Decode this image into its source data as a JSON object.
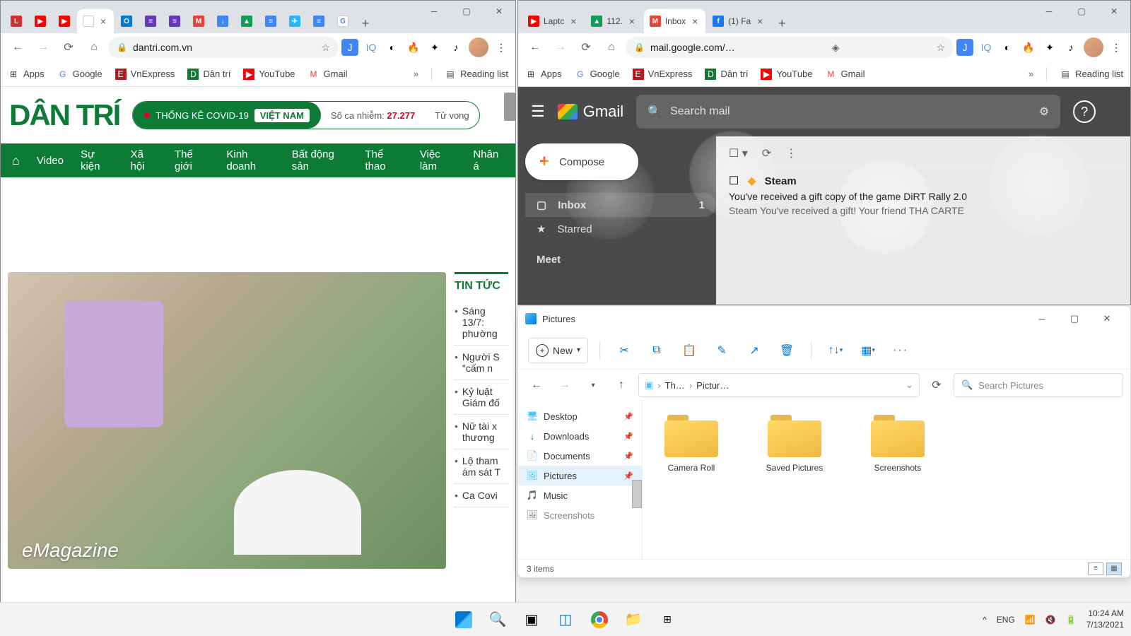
{
  "left_chrome": {
    "tabs": [
      {
        "favicon_bg": "#d32f2f",
        "favicon_text": "L"
      },
      {
        "favicon_bg": "#ff0000",
        "favicon_text": "▶"
      },
      {
        "favicon_bg": "#ff0000",
        "favicon_text": "▶"
      },
      {
        "favicon_bg": "#fff",
        "favicon_text": "",
        "active": true,
        "closable": true
      },
      {
        "favicon_bg": "#0078d4",
        "favicon_text": "O"
      },
      {
        "favicon_bg": "#673ab7",
        "favicon_text": "≡"
      },
      {
        "favicon_bg": "#673ab7",
        "favicon_text": "≡"
      },
      {
        "favicon_bg": "#ea4335",
        "favicon_text": "M"
      },
      {
        "favicon_bg": "#4285f4",
        "favicon_text": "↓"
      },
      {
        "favicon_bg": "#0f9d58",
        "favicon_text": "▲"
      },
      {
        "favicon_bg": "#4285f4",
        "favicon_text": "≡"
      },
      {
        "favicon_bg": "#29b6f6",
        "favicon_text": "✈"
      },
      {
        "favicon_bg": "#4285f4",
        "favicon_text": "≡"
      },
      {
        "favicon_bg": "#fff",
        "favicon_text": "G"
      }
    ],
    "url": "dantri.com.vn",
    "bookmarks": [
      {
        "icon": "⊞",
        "label": "Apps"
      },
      {
        "icon": "G",
        "label": "Google"
      },
      {
        "icon": "E",
        "label": "VnExpress",
        "icon_bg": "#b71c1c"
      },
      {
        "icon": "D",
        "label": "Dân trí",
        "icon_bg": "#0d7a36"
      },
      {
        "icon": "▶",
        "label": "YouTube",
        "icon_bg": "#ff0000"
      },
      {
        "icon": "M",
        "label": "Gmail"
      }
    ],
    "overflow": "»",
    "reading_list": "Reading list"
  },
  "dantri": {
    "logo": "DÂN TRÍ",
    "covid_label": "THỐNG KÊ COVID-19",
    "covid_vn": "VIỆT NAM",
    "stats_label": "Số ca nhiễm:",
    "stats_num": "27.277",
    "stats_right": "Tử vong",
    "nav": [
      "Video",
      "Sự kiện",
      "Xã hội",
      "Thế giới",
      "Kinh doanh",
      "Bất động sản",
      "Thể thao",
      "Việc làm",
      "Nhân á"
    ],
    "hero_tag": "eMagazine",
    "sidebar_title": "TIN TỨC",
    "items": [
      "Sáng 13/7: phường",
      "Người S \"cấm n",
      "Kỷ luật Giám đố",
      "Nữ tài x thương",
      "Lộ tham ám sát T",
      "Ca Covi"
    ]
  },
  "right_chrome": {
    "tabs": [
      {
        "favicon_bg": "#ff0000",
        "favicon_text": "▶",
        "label": "Laptc",
        "closable": true
      },
      {
        "favicon_bg": "#0f9d58",
        "favicon_text": "▲",
        "label": "112.",
        "closable": true
      },
      {
        "favicon_bg": "#ea4335",
        "favicon_text": "M",
        "label": "Inbox",
        "closable": true,
        "active": true
      },
      {
        "favicon_bg": "#1877f2",
        "favicon_text": "f",
        "label": "(1) Fa",
        "closable": true
      }
    ],
    "url": "mail.google.com/…",
    "bookmarks": [
      {
        "icon": "⊞",
        "label": "Apps"
      },
      {
        "icon": "G",
        "label": "Google"
      },
      {
        "icon": "E",
        "label": "VnExpress",
        "icon_bg": "#b71c1c"
      },
      {
        "icon": "D",
        "label": "Dân trí",
        "icon_bg": "#0d7a36"
      },
      {
        "icon": "▶",
        "label": "YouTube",
        "icon_bg": "#ff0000"
      },
      {
        "icon": "M",
        "label": "Gmail"
      }
    ],
    "overflow": "»",
    "reading_list": "Reading list"
  },
  "gmail": {
    "brand": "Gmail",
    "search_ph": "Search mail",
    "compose": "Compose",
    "nav": [
      {
        "icon": "▢",
        "label": "Inbox",
        "count": "1",
        "active": true
      },
      {
        "icon": "★",
        "label": "Starred"
      },
      {
        "icon": "",
        "label": "Meet"
      }
    ],
    "mail": {
      "sender": "Steam",
      "subject": "You've received a gift copy of the game DiRT Rally 2.0",
      "preview": "Steam You've received a gift! Your friend THA CARTE"
    }
  },
  "explorer": {
    "title": "Pictures",
    "new_btn": "New",
    "path": [
      "Th…",
      "Pictur…"
    ],
    "search_ph": "Search Pictures",
    "nav": [
      {
        "icon": "🖥",
        "label": "Desktop"
      },
      {
        "icon": "↓",
        "label": "Downloads"
      },
      {
        "icon": "📄",
        "label": "Documents"
      },
      {
        "icon": "🖼",
        "label": "Pictures",
        "active": true
      },
      {
        "icon": "🎵",
        "label": "Music"
      },
      {
        "icon": "🖼",
        "label": "Screenshots"
      }
    ],
    "folders": [
      "Camera Roll",
      "Saved Pictures",
      "Screenshots"
    ],
    "status": "3 items"
  },
  "taskbar": {
    "lang": "ENG",
    "time": "10:24 AM",
    "date": "7/13/2021"
  }
}
